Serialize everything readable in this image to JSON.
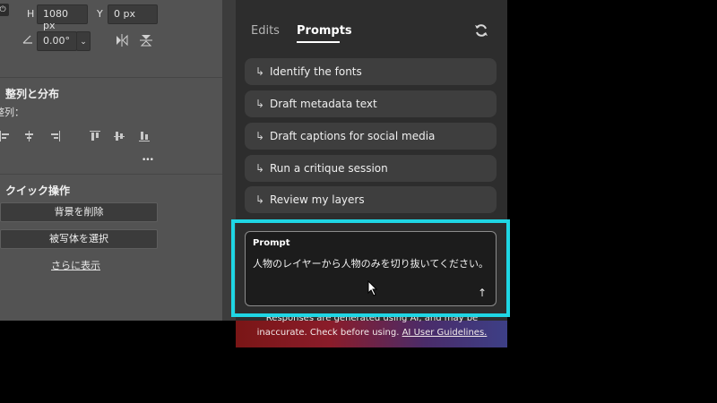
{
  "properties": {
    "height_label": "H",
    "height_value": "1080 px",
    "y_label": "Y",
    "y_value": "0 px",
    "angle_value": "0.00°",
    "align_title": "整列と分布",
    "align_label": "整列：",
    "more_dots": "•••",
    "quick_title": "クイック操作",
    "remove_bg": "背景を削除",
    "select_subject": "被写体を選択",
    "show_more": "さらに表示"
  },
  "ai_panel": {
    "tabs": [
      "Edits",
      "Prompts"
    ],
    "active_tab": "Prompts",
    "suggestions": [
      "Identify the fonts",
      "Draft metadata text",
      "Draft captions for social media",
      "Run a critique session",
      "Review my layers"
    ],
    "prompt_label": "Prompt",
    "prompt_value": "人物のレイヤーから人物のみを切り抜いてください。",
    "disclaimer_text": "Responses are generated using AI, and may be inaccurate. Check before using.",
    "guidelines_link": "AI User Guidelines.",
    "highlight_color": "#1fd6e4",
    "icons": [
      "refresh-icon",
      "suggestion-arrow-icon",
      "send-arrow-icon",
      "mouse-cursor-icon"
    ]
  }
}
